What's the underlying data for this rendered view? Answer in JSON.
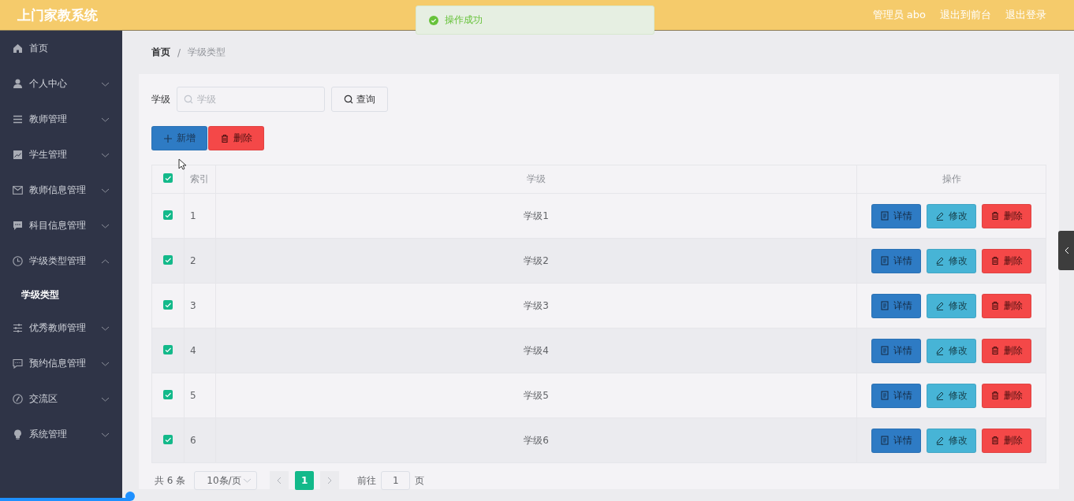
{
  "header": {
    "title": "上门家教系统",
    "user": "管理员 abo",
    "links": [
      "退出到前台",
      "退出登录"
    ]
  },
  "toast": {
    "message": "操作成功"
  },
  "sidebar": {
    "items": [
      {
        "label": "首页",
        "kind": "link",
        "selected": false
      },
      {
        "label": "个人中心",
        "kind": "submenu",
        "expanded": false
      },
      {
        "label": "教师管理",
        "kind": "submenu",
        "expanded": false
      },
      {
        "label": "学生管理",
        "kind": "submenu",
        "expanded": false
      },
      {
        "label": "教师信息管理",
        "kind": "submenu",
        "expanded": false
      },
      {
        "label": "科目信息管理",
        "kind": "submenu",
        "expanded": false
      },
      {
        "label": "学级类型管理",
        "kind": "submenu",
        "expanded": true,
        "children": [
          {
            "label": "学级类型",
            "selected": true
          }
        ]
      },
      {
        "label": "优秀教师管理",
        "kind": "submenu",
        "expanded": false
      },
      {
        "label": "预约信息管理",
        "kind": "submenu",
        "expanded": false
      },
      {
        "label": "交流区",
        "kind": "submenu",
        "expanded": false
      },
      {
        "label": "系统管理",
        "kind": "submenu",
        "expanded": false
      }
    ]
  },
  "breadcrumb": {
    "separator": "/",
    "items": [
      "首页",
      "学级类型"
    ]
  },
  "search": {
    "label": "学级",
    "placeholder": "学级",
    "button": "查询"
  },
  "actions": [
    {
      "label": "新增",
      "kind": "add"
    },
    {
      "label": "删除",
      "kind": "delete"
    }
  ],
  "table": {
    "all_checked": true,
    "columns": [
      "索引",
      "学级",
      "操作"
    ],
    "rows": [
      {
        "checked": true,
        "index": "1",
        "grade": "学级1",
        "actions": [
          {
            "label": "详情",
            "kind": "detail"
          },
          {
            "label": "修改",
            "kind": "edit"
          },
          {
            "label": "删除",
            "kind": "delete"
          }
        ]
      },
      {
        "checked": true,
        "index": "2",
        "grade": "学级2",
        "actions": [
          {
            "label": "详情",
            "kind": "detail"
          },
          {
            "label": "修改",
            "kind": "edit"
          },
          {
            "label": "删除",
            "kind": "delete"
          }
        ]
      },
      {
        "checked": true,
        "index": "3",
        "grade": "学级3",
        "actions": [
          {
            "label": "详情",
            "kind": "detail"
          },
          {
            "label": "修改",
            "kind": "edit"
          },
          {
            "label": "删除",
            "kind": "delete"
          }
        ]
      },
      {
        "checked": true,
        "index": "4",
        "grade": "学级4",
        "actions": [
          {
            "label": "详情",
            "kind": "detail"
          },
          {
            "label": "修改",
            "kind": "edit"
          },
          {
            "label": "删除",
            "kind": "delete"
          }
        ]
      },
      {
        "checked": true,
        "index": "5",
        "grade": "学级5",
        "actions": [
          {
            "label": "详情",
            "kind": "detail"
          },
          {
            "label": "修改",
            "kind": "edit"
          },
          {
            "label": "删除",
            "kind": "delete"
          }
        ]
      },
      {
        "checked": true,
        "index": "6",
        "grade": "学级6",
        "actions": [
          {
            "label": "详情",
            "kind": "detail"
          },
          {
            "label": "修改",
            "kind": "edit"
          },
          {
            "label": "删除",
            "kind": "delete"
          }
        ]
      }
    ]
  },
  "pagination": {
    "total": "共 6 条",
    "page_size": "10条/页",
    "pages": [
      {
        "label": "1",
        "selected": true
      }
    ],
    "goto_label": "前往",
    "goto_value": "1",
    "page_suffix": "页"
  }
}
